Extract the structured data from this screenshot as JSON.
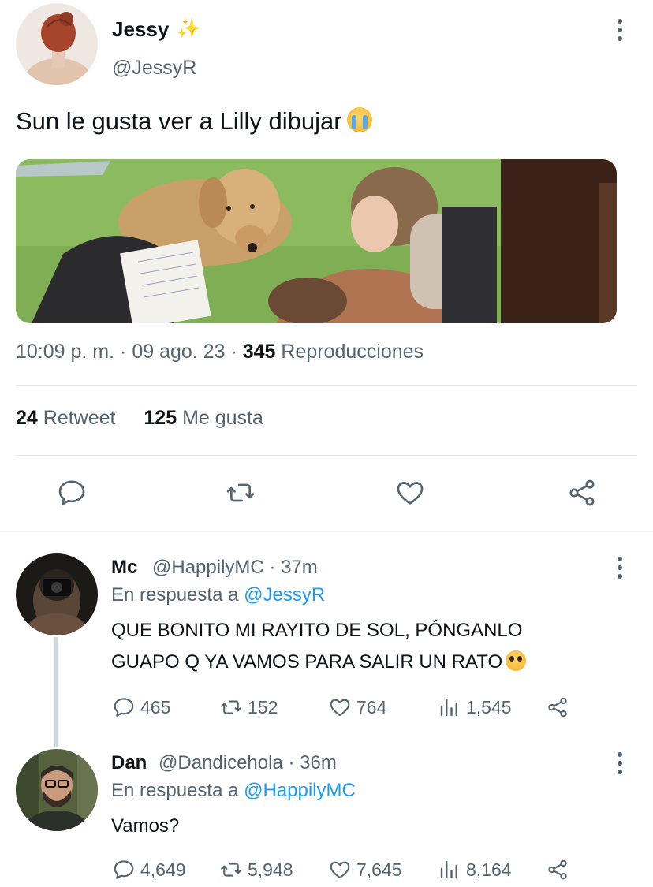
{
  "tweet": {
    "author_name": "Jessy",
    "author_badge": "✨",
    "author_handle": "@JessyR",
    "text": "Sun le gusta ver a Lilly dibujar",
    "text_emoji": "loudly-crying-face",
    "time": "10:09 p. m.",
    "date": "09 ago. 23",
    "views_count": "345",
    "views_label": "Reproducciones",
    "retweets_count": "24",
    "retweets_label": "Retweet",
    "likes_count": "125",
    "likes_label": "Me gusta",
    "actions": [
      "reply-icon",
      "retweet-icon",
      "like-icon",
      "share-icon"
    ]
  },
  "replies": [
    {
      "name": "Mc",
      "handle": "@HappilyMC",
      "time": "37m",
      "reply_prefix": "En respuesta a",
      "reply_to": "@JessyR",
      "text": "QUE BONITO MI RAYITO DE SOL, PÓNGANLO GUAPO Q YA VAMOS PARA SALIR UN RATO",
      "text_emoji": "flushed-face",
      "replies": "465",
      "retweets": "152",
      "likes": "764",
      "views": "1,545"
    },
    {
      "name": "Dan",
      "handle": "@Dandicehola",
      "time": "36m",
      "reply_prefix": "En respuesta a",
      "reply_to": "@HappilyMC",
      "text": "Vamos?",
      "replies": "4,649",
      "retweets": "5,948",
      "likes": "7,645",
      "views": "8,164"
    }
  ],
  "colors": {
    "text": "#0f1419",
    "secondary": "#536471",
    "link": "#1d9bf0",
    "divider": "#e5e7ea"
  }
}
